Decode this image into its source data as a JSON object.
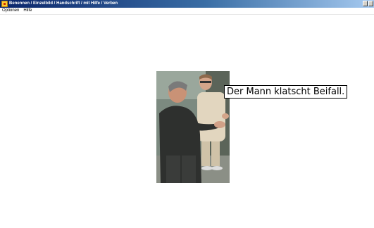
{
  "window": {
    "title": "Benennen / Einzelbild / Handschrift / mit Hilfe / Verben"
  },
  "menu": {
    "items": [
      "Optionen",
      "Hilfe"
    ]
  },
  "exercise": {
    "image_icon": "photo-two-men-clapping",
    "caption": "Der Mann klatscht Beifall."
  }
}
